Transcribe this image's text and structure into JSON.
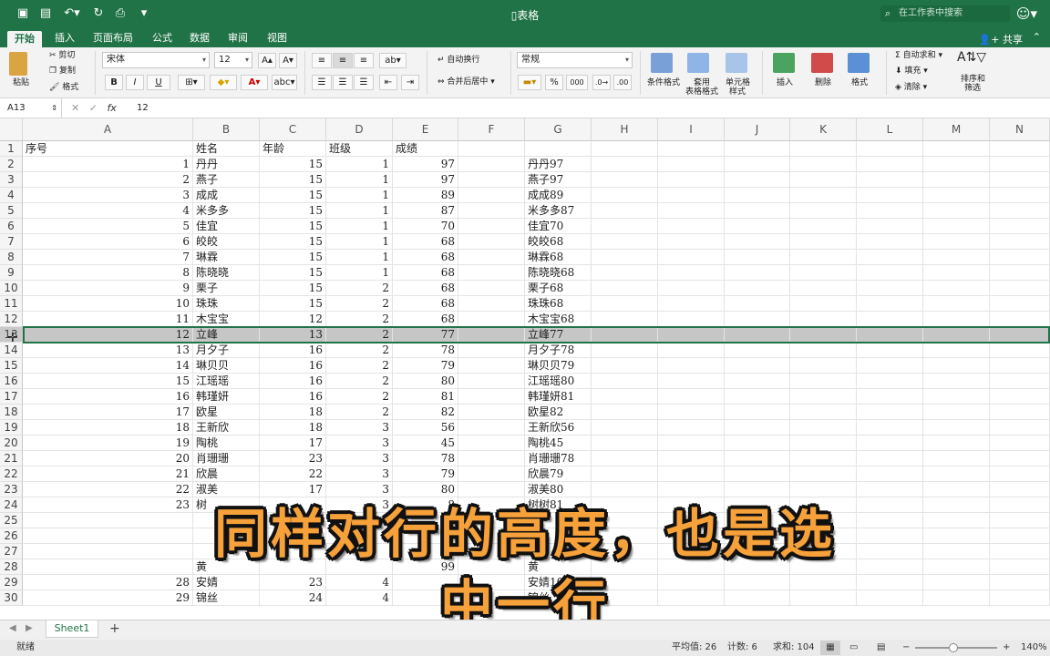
{
  "app": {
    "title": "表格",
    "search_placeholder": "在工作表中搜索",
    "share": "共享"
  },
  "tabs": [
    "开始",
    "插入",
    "页面布局",
    "公式",
    "数据",
    "审阅",
    "视图"
  ],
  "ribbon": {
    "paste": "粘贴",
    "cut": "剪切",
    "copy": "复制",
    "format_painter": "格式",
    "font_name": "宋体",
    "font_size": "12",
    "bold": "B",
    "italic": "I",
    "underline": "U",
    "wrap_text": "自动换行",
    "merge_center": "合并后居中",
    "number_format": "常规",
    "percent": "%",
    "thousands": "000",
    "cond_format": "条件格式",
    "table_format_1": "套用",
    "table_format_2": "表格格式",
    "cell_style_1": "单元格",
    "cell_style_2": "样式",
    "insert": "插入",
    "delete": "删除",
    "format": "格式",
    "autosum": "自动求和",
    "fill": "填充",
    "clear": "清除",
    "sort_filter_1": "排序和",
    "sort_filter_2": "筛选"
  },
  "formula_bar": {
    "name_box": "A13",
    "fx": "fx",
    "value": "12"
  },
  "columns": [
    "A",
    "B",
    "C",
    "D",
    "E",
    "F",
    "G",
    "H",
    "I",
    "J",
    "K",
    "L",
    "M",
    "N"
  ],
  "rows": [
    {
      "n": "1",
      "a": "序号",
      "b": "姓名",
      "c": "年龄",
      "d": "班级",
      "e": "成绩",
      "g": ""
    },
    {
      "n": "2",
      "a": "1",
      "b": "丹丹",
      "c": "15",
      "d": "1",
      "e": "97",
      "g": "丹丹97"
    },
    {
      "n": "3",
      "a": "2",
      "b": "燕子",
      "c": "15",
      "d": "1",
      "e": "97",
      "g": "燕子97"
    },
    {
      "n": "4",
      "a": "3",
      "b": "成成",
      "c": "15",
      "d": "1",
      "e": "89",
      "g": "成成89"
    },
    {
      "n": "5",
      "a": "4",
      "b": "米多多",
      "c": "15",
      "d": "1",
      "e": "87",
      "g": "米多多87"
    },
    {
      "n": "6",
      "a": "5",
      "b": "佳宜",
      "c": "15",
      "d": "1",
      "e": "70",
      "g": "佳宜70"
    },
    {
      "n": "7",
      "a": "6",
      "b": "皎皎",
      "c": "15",
      "d": "1",
      "e": "68",
      "g": "皎皎68"
    },
    {
      "n": "8",
      "a": "7",
      "b": "琳霖",
      "c": "15",
      "d": "1",
      "e": "68",
      "g": "琳霖68"
    },
    {
      "n": "9",
      "a": "8",
      "b": "陈晓晓",
      "c": "15",
      "d": "1",
      "e": "68",
      "g": "陈晓晓68"
    },
    {
      "n": "10",
      "a": "9",
      "b": "栗子",
      "c": "15",
      "d": "2",
      "e": "68",
      "g": "栗子68"
    },
    {
      "n": "11",
      "a": "10",
      "b": "珠珠",
      "c": "15",
      "d": "2",
      "e": "68",
      "g": "珠珠68"
    },
    {
      "n": "12",
      "a": "11",
      "b": "木宝宝",
      "c": "12",
      "d": "2",
      "e": "68",
      "g": "木宝宝68"
    },
    {
      "n": "13",
      "a": "12",
      "b": "立峰",
      "c": "13",
      "d": "2",
      "e": "77",
      "g": "立峰77"
    },
    {
      "n": "14",
      "a": "13",
      "b": "月夕子",
      "c": "16",
      "d": "2",
      "e": "78",
      "g": "月夕子78"
    },
    {
      "n": "15",
      "a": "14",
      "b": "琳贝贝",
      "c": "16",
      "d": "2",
      "e": "79",
      "g": "琳贝贝79"
    },
    {
      "n": "16",
      "a": "15",
      "b": "江瑶瑶",
      "c": "16",
      "d": "2",
      "e": "80",
      "g": "江瑶瑶80"
    },
    {
      "n": "17",
      "a": "16",
      "b": "韩瑾妍",
      "c": "16",
      "d": "2",
      "e": "81",
      "g": "韩瑾妍81"
    },
    {
      "n": "18",
      "a": "17",
      "b": "欧星",
      "c": "18",
      "d": "2",
      "e": "82",
      "g": "欧星82"
    },
    {
      "n": "19",
      "a": "18",
      "b": "王新欣",
      "c": "18",
      "d": "3",
      "e": "56",
      "g": "王新欣56"
    },
    {
      "n": "20",
      "a": "19",
      "b": "陶桃",
      "c": "17",
      "d": "3",
      "e": "45",
      "g": "陶桃45"
    },
    {
      "n": "21",
      "a": "20",
      "b": "肖珊珊",
      "c": "23",
      "d": "3",
      "e": "78",
      "g": "肖珊珊78"
    },
    {
      "n": "22",
      "a": "21",
      "b": "欣晨",
      "c": "22",
      "d": "3",
      "e": "79",
      "g": "欣晨79"
    },
    {
      "n": "23",
      "a": "22",
      "b": "淑美",
      "c": "17",
      "d": "3",
      "e": "80",
      "g": "淑美80"
    },
    {
      "n": "24",
      "a": "23",
      "b": "树",
      "c": "",
      "d": "3",
      "e": "8",
      "g": "树树81"
    },
    {
      "n": "25",
      "a": "",
      "b": "",
      "c": "",
      "d": "",
      "e": "",
      "g": ""
    },
    {
      "n": "26",
      "a": "",
      "b": "",
      "c": "",
      "d": "",
      "e": "",
      "g": ""
    },
    {
      "n": "27",
      "a": "",
      "b": "",
      "c": "",
      "d": "",
      "e": "",
      "g": ""
    },
    {
      "n": "28",
      "a": "",
      "b": "黄",
      "c": "",
      "d": "",
      "e": "99",
      "g": "黄"
    },
    {
      "n": "29",
      "a": "28",
      "b": "安婧",
      "c": "23",
      "d": "4",
      "e": "",
      "g": "安婧100"
    },
    {
      "n": "30",
      "a": "29",
      "b": "锦丝",
      "c": "24",
      "d": "4",
      "e": "",
      "g": "锦丝"
    }
  ],
  "selected_row": 13,
  "sheet": {
    "name": "Sheet1",
    "add": "+"
  },
  "status": {
    "ready": "就绪",
    "average": "平均值: 26",
    "count": "计数: 6",
    "sum": "求和: 104",
    "zoom": "140%"
  },
  "overlay": {
    "line1": "同样对行的高度，也是选",
    "line2": "中一行"
  },
  "colors": {
    "accent": "#207346",
    "caption_fill": "#f6a13a",
    "caption_stroke": "#111111"
  }
}
